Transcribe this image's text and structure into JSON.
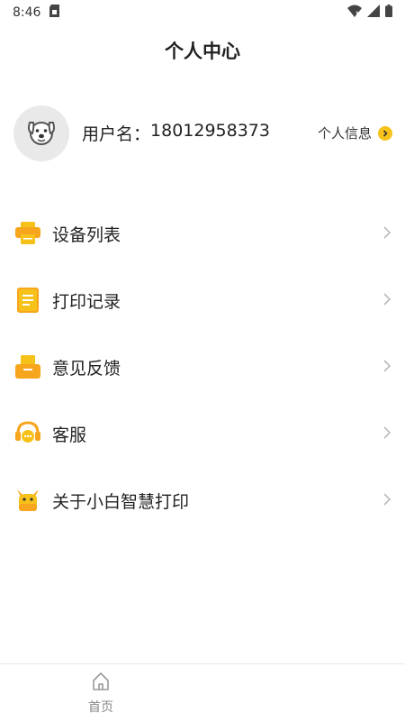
{
  "status_bar": {
    "time": "8:46"
  },
  "header": {
    "title": "个人中心"
  },
  "profile": {
    "username_prefix": "用户名：",
    "username_value": "18012958373",
    "info_link": "个人信息",
    "avatar_icon": "dog-avatar-icon"
  },
  "menu": {
    "items": [
      {
        "label": "设备列表",
        "icon": "printer-icon"
      },
      {
        "label": "打印记录",
        "icon": "document-icon"
      },
      {
        "label": "意见反馈",
        "icon": "feedback-box-icon"
      },
      {
        "label": "客服",
        "icon": "headset-icon"
      },
      {
        "label": "关于小白智慧打印",
        "icon": "mascot-icon"
      }
    ]
  },
  "tab_bar": {
    "home_label": "首页",
    "home_icon": "home-icon"
  },
  "colors": {
    "accent": "#f6c21a",
    "icon_orange": "#f7a51c",
    "icon_yellow": "#f6c21a"
  }
}
